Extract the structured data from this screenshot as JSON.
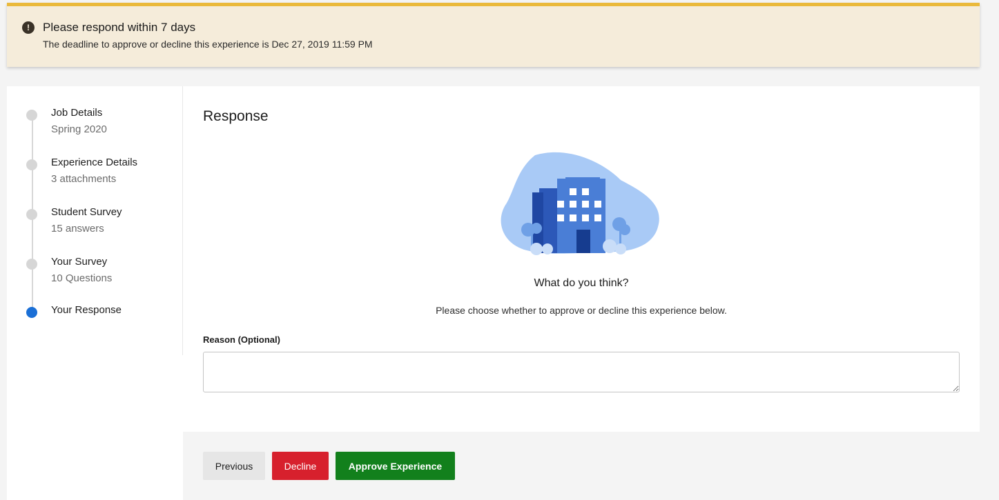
{
  "banner": {
    "icon": "exclamation-circle-icon",
    "title": "Please respond within 7 days",
    "subtitle": "The deadline to approve or decline this experience is Dec 27, 2019 11:59 PM",
    "accent_color": "#eab93b"
  },
  "steps": [
    {
      "title": "Job Details",
      "subtitle": "Spring 2020",
      "active": false
    },
    {
      "title": "Experience Details",
      "subtitle": "3 attachments",
      "active": false
    },
    {
      "title": "Student Survey",
      "subtitle": "15 answers",
      "active": false
    },
    {
      "title": "Your Survey",
      "subtitle": "10 Questions",
      "active": false
    },
    {
      "title": "Your Response",
      "subtitle": "",
      "active": true
    }
  ],
  "main": {
    "section_title": "Response",
    "illustration": "building-illustration",
    "question": "What do you think?",
    "instruction": "Please choose whether to approve or decline this experience below.",
    "reason_label": "Reason (Optional)",
    "reason_value": ""
  },
  "buttons": {
    "previous": "Previous",
    "decline": "Decline",
    "approve": "Approve Experience"
  },
  "colors": {
    "active_step": "#1a6fd6",
    "decline": "#d7202d",
    "approve": "#12801c"
  }
}
